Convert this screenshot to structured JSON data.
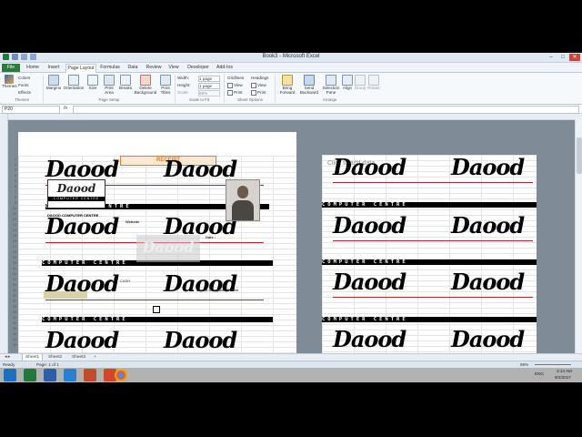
{
  "window": {
    "title": "Book3 - Microsoft Excel",
    "controls": [
      "–",
      "□",
      "✕"
    ]
  },
  "tabs": [
    "File",
    "Home",
    "Insert",
    "Page Layout",
    "Formulas",
    "Data",
    "Review",
    "View",
    "Developer",
    "Add-Ins"
  ],
  "active_tab": "Page Layout",
  "ribbon": {
    "themes": {
      "label": "Themes",
      "colors": "Colors",
      "fonts": "Fonts",
      "effects": "Effects",
      "group": "Themes"
    },
    "page_setup": {
      "margins": "Margins",
      "orientation": "Orientation",
      "size": "Size",
      "print_area": "Print Area",
      "breaks": "Breaks",
      "background": "Delete Background",
      "print_titles": "Print Titles",
      "group": "Page Setup"
    },
    "scale": {
      "width_label": "Width:",
      "width_val": "1 page",
      "height_label": "Height:",
      "height_val": "1 page",
      "scale_label": "Scale:",
      "scale_val": "89%",
      "group": "Scale to Fit"
    },
    "sheet_options": {
      "gridlines": "Gridlines",
      "headings": "Headings",
      "view": "View",
      "print": "Print",
      "group": "Sheet Options"
    },
    "arrange": {
      "bring_forward": "Bring Forward",
      "send_backward": "Send Backward",
      "selection_pane": "Selection Pane",
      "align": "Align",
      "group_label": "Group",
      "rotate": "Rotate",
      "group": "Arrange"
    }
  },
  "formula_bar": {
    "name_box": "P20",
    "fx": "fx",
    "value": ""
  },
  "sheet": {
    "receipt_title": "RECEIPT",
    "click_add_data": "Click to add data",
    "brand_script": "Daood",
    "brand_band": "COMPUTER CENTRE",
    "company_name": "DAOOD COMPUTER CENTRE",
    "website_label": "Website",
    "date_label": "Date :",
    "cash_label": "CASH",
    "footer_name": "Daood Computer Centre",
    "row_numbers": [
      "1",
      "2",
      "3",
      "4",
      "5",
      "6",
      "7",
      "8",
      "9",
      "10",
      "11",
      "12",
      "13",
      "14",
      "15",
      "16",
      "17",
      "18",
      "19",
      "20",
      "21",
      "22",
      "23",
      "24",
      "25",
      "26",
      "27",
      "28",
      "29",
      "30",
      "31",
      "32",
      "33",
      "34",
      "35"
    ]
  },
  "sheet_tabs": [
    "Sheet1",
    "Sheet2",
    "Sheet3"
  ],
  "active_sheet": "Sheet1",
  "status": {
    "ready": "Ready",
    "page": "Page: 1 of 1",
    "zoom": "89%"
  },
  "taskbar": {
    "time": "3:14 AM",
    "date": "9/2/2017",
    "lang": "ENG"
  },
  "colors": {
    "accent_green": "#2c7a3b",
    "receipt_orange": "#e07b22",
    "brand_red": "#b3242c"
  }
}
